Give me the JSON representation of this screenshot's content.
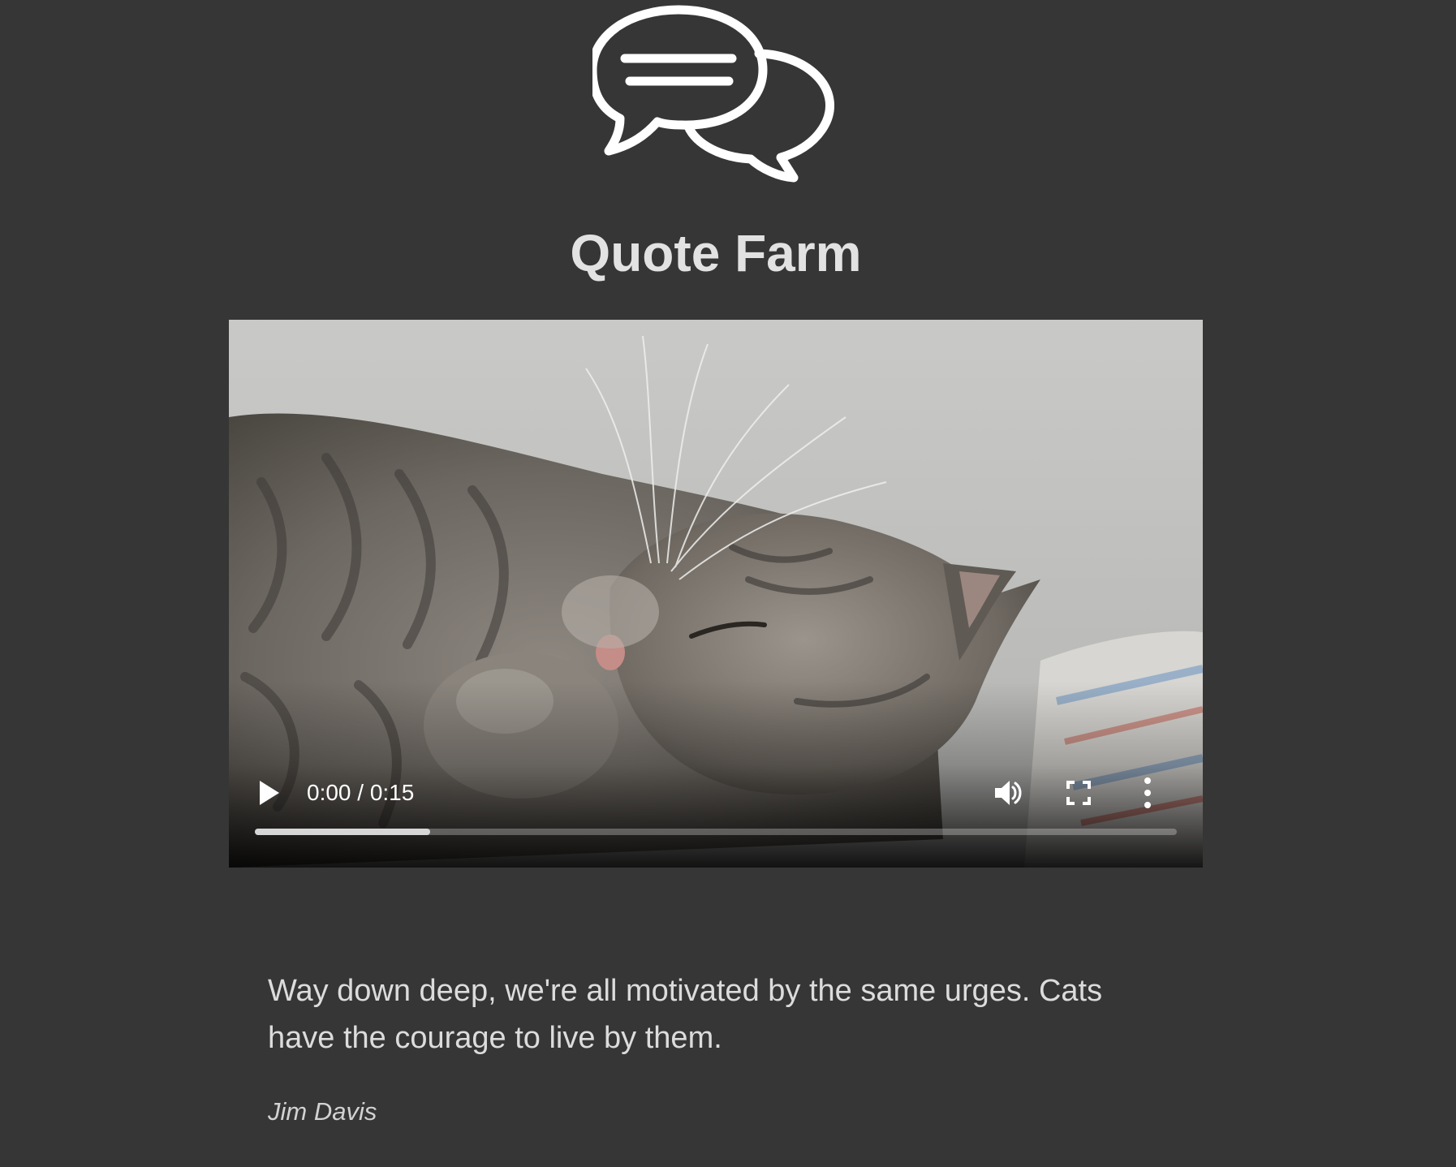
{
  "app": {
    "title": "Quote Farm",
    "logo_icon": "speech-bubbles-icon"
  },
  "video": {
    "subject": "sleeping-tabby-cat",
    "time_display": "0:00 / 0:15",
    "buffered_fraction": 0.19,
    "controls": {
      "play_icon": "play-icon",
      "volume_icon": "volume-icon",
      "fullscreen_icon": "fullscreen-icon",
      "more_icon": "more-options-icon"
    }
  },
  "quote": {
    "text": "Way down deep, we're all motivated by the same urges. Cats have the courage to live by them.",
    "author": "Jim Davis"
  },
  "colors": {
    "background": "#363636",
    "title": "#e2e2e2",
    "text": "#dcdcdc",
    "progress_fill": "#d6d6d6"
  }
}
